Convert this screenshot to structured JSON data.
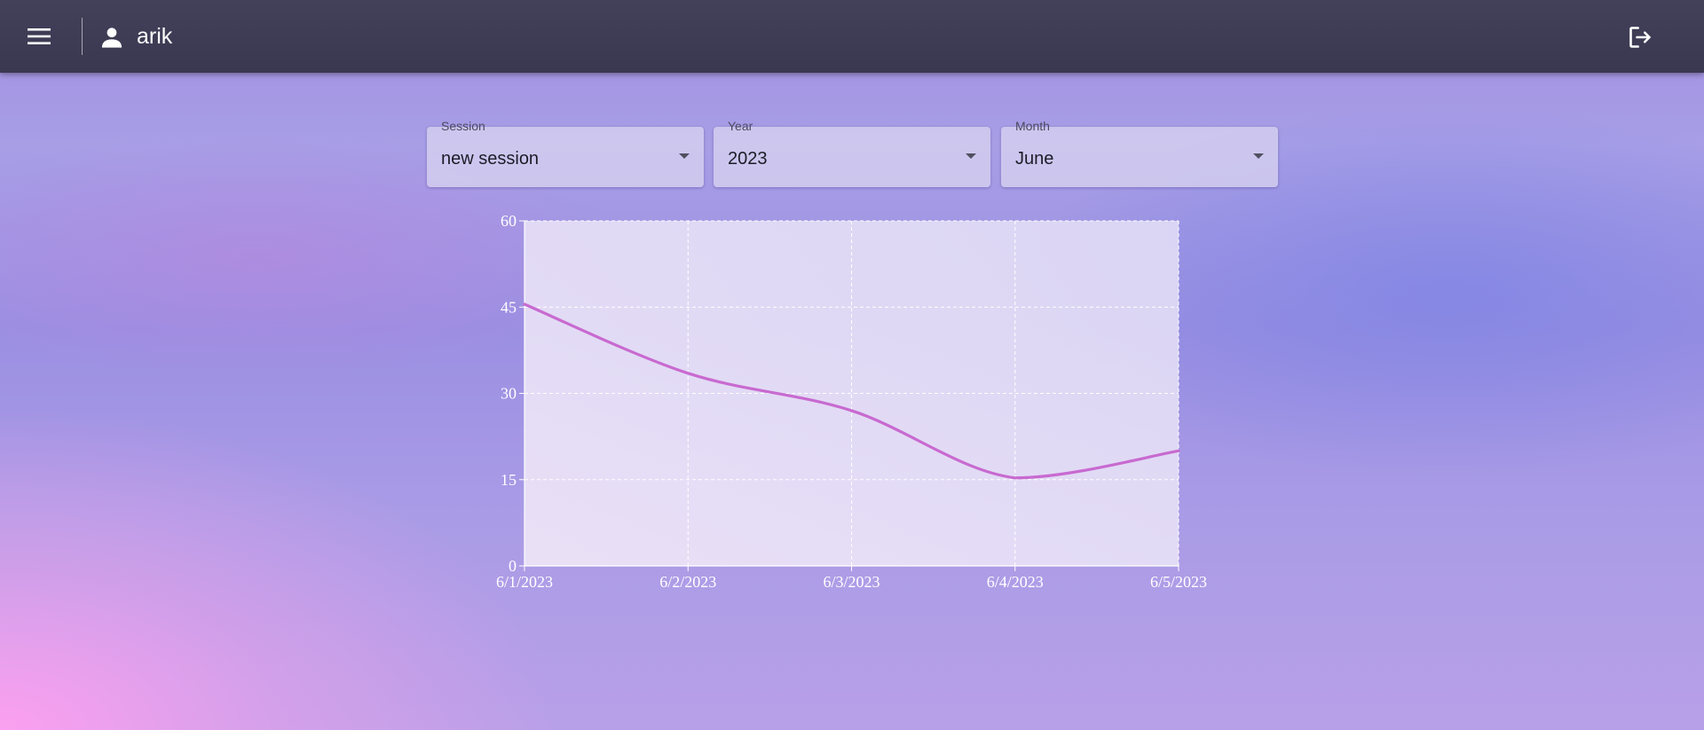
{
  "header": {
    "username": "arik",
    "menu_icon": "hamburger-menu-icon",
    "user_icon": "person-icon",
    "logout_icon": "logout-icon",
    "background": "#3d3b53"
  },
  "filters": {
    "session": {
      "label": "Session",
      "value": "new session"
    },
    "year": {
      "label": "Year",
      "value": "2023"
    },
    "month": {
      "label": "Month",
      "value": "June"
    }
  },
  "chart_data": {
    "type": "line",
    "x": [
      "6/1/2023",
      "6/2/2023",
      "6/3/2023",
      "6/4/2023",
      "6/5/2023"
    ],
    "series": [
      {
        "values": [
          45.5,
          33.5,
          27,
          15.3,
          20
        ],
        "color": "#c86ad0"
      }
    ],
    "yticks": [
      "0",
      "15",
      "30",
      "45",
      "60"
    ],
    "ylim": [
      0,
      60
    ],
    "grid": true,
    "curve": "smooth"
  }
}
